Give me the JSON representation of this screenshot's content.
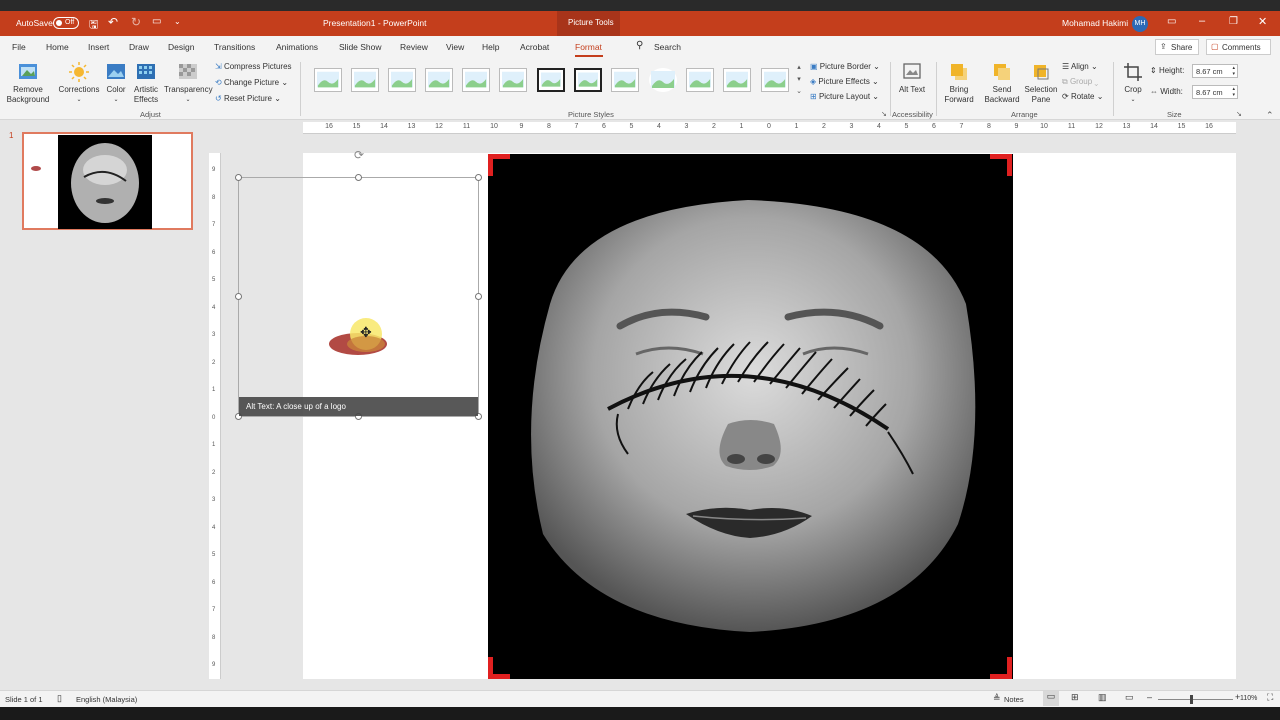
{
  "titlebar": {
    "autosave_label": "AutoSave",
    "autosave_state": "Off",
    "doc_title": "Presentation1  -  PowerPoint",
    "context_title": "Picture Tools",
    "user_name": "Mohamad Hakimi",
    "user_initials": "MH"
  },
  "tabs": [
    "File",
    "Home",
    "Insert",
    "Draw",
    "Design",
    "Transitions",
    "Animations",
    "Slide Show",
    "Review",
    "View",
    "Help",
    "Acrobat",
    "Format"
  ],
  "active_tab": "Format",
  "search_label": "Search",
  "share_label": "Share",
  "comments_label": "Comments",
  "ribbon": {
    "adjust": {
      "remove_background": "Remove Background",
      "corrections": "Corrections",
      "color": "Color",
      "artistic_effects": "Artistic Effects",
      "transparency": "Transparency",
      "compress": "Compress Pictures",
      "change": "Change Picture",
      "reset": "Reset Picture",
      "group_label": "Adjust"
    },
    "picture_styles": {
      "border": "Picture Border",
      "effects": "Picture Effects",
      "layout": "Picture Layout",
      "group_label": "Picture Styles"
    },
    "accessibility": {
      "alt_text": "Alt Text",
      "group_label": "Accessibility"
    },
    "arrange": {
      "bring_forward": "Bring Forward",
      "send_backward": "Send Backward",
      "selection_pane": "Selection Pane",
      "align": "Align",
      "group": "Group",
      "rotate": "Rotate",
      "group_label": "Arrange"
    },
    "size": {
      "crop": "Crop",
      "height_label": "Height:",
      "height_value": "8.67 cm",
      "width_label": "Width:",
      "width_value": "8.67 cm",
      "group_label": "Size"
    }
  },
  "ruler_ticks": [
    "16",
    "15",
    "14",
    "13",
    "12",
    "11",
    "10",
    "9",
    "8",
    "7",
    "6",
    "5",
    "4",
    "3",
    "2",
    "1",
    "0",
    "1",
    "2",
    "3",
    "4",
    "5",
    "6",
    "7",
    "8",
    "9",
    "10",
    "11",
    "12",
    "13",
    "14",
    "15",
    "16"
  ],
  "vruler_ticks": [
    "9",
    "8",
    "7",
    "6",
    "5",
    "4",
    "3",
    "2",
    "1",
    "0",
    "1",
    "2",
    "3",
    "4",
    "5",
    "6",
    "7",
    "8",
    "9"
  ],
  "slide_number": "1",
  "alt_text_caption": "Alt Text: A close up of a logo",
  "status": {
    "slide_info": "Slide 1 of 1",
    "language": "English (Malaysia)",
    "notes": "Notes",
    "zoom": "110%"
  },
  "colors": {
    "brand": "#c43e1c",
    "crop_marks": "#e02020"
  }
}
